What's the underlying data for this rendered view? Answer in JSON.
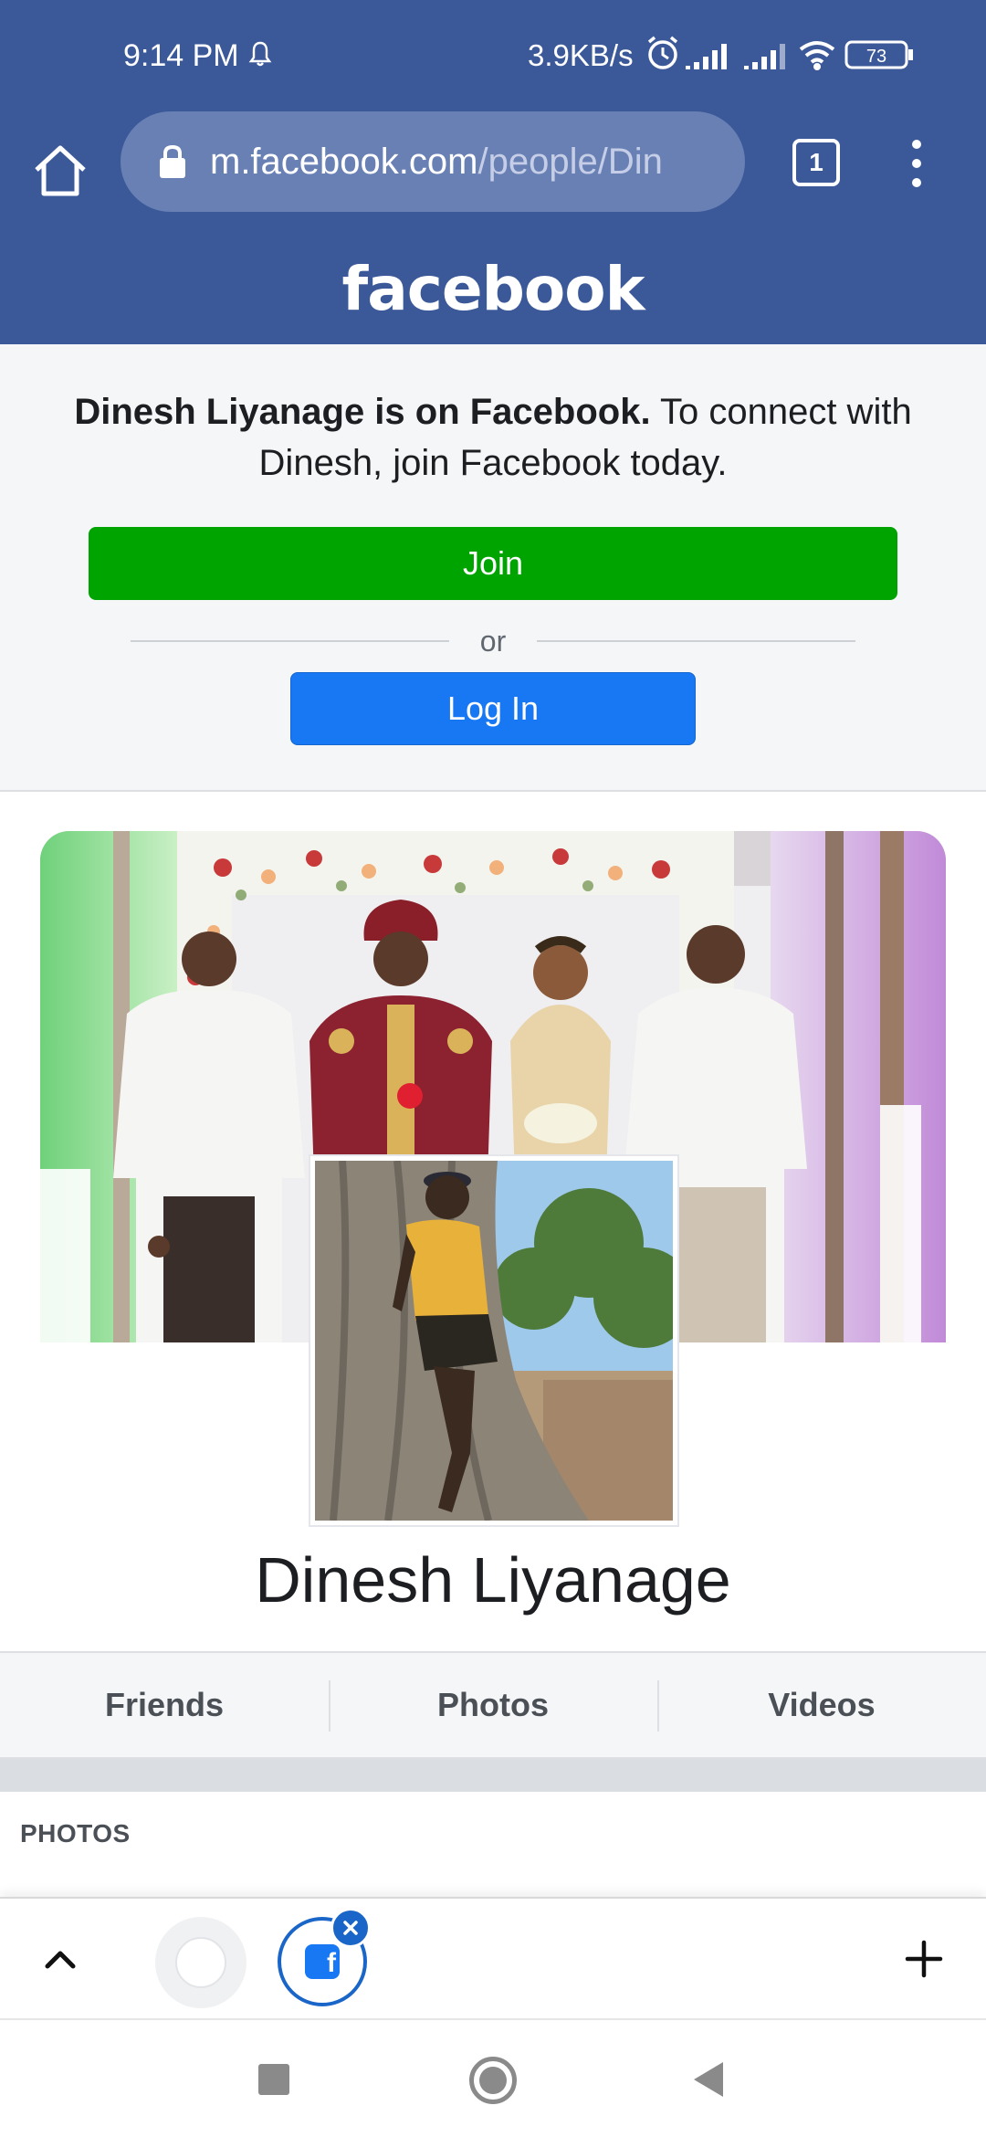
{
  "status_bar": {
    "time": "9:14 PM",
    "network_speed": "3.9KB/s",
    "battery": "73",
    "icons": [
      "bell-icon",
      "alarm-icon",
      "signal-icon",
      "signal-icon",
      "wifi-icon",
      "battery-icon"
    ]
  },
  "browser": {
    "url_host": "m.facebook.com",
    "url_path": "/people/Din",
    "tab_count": "1"
  },
  "header": {
    "logo": "facebook"
  },
  "promo": {
    "bold_text": "Dinesh Liyanage is on Facebook.",
    "rest_text": " To connect with Dinesh, join Facebook today.",
    "join_label": "Join",
    "or_label": "or",
    "login_label": "Log In"
  },
  "profile": {
    "name": "Dinesh Liyanage"
  },
  "profile_nav": [
    {
      "label": "Friends"
    },
    {
      "label": "Photos"
    },
    {
      "label": "Videos"
    }
  ],
  "photos_section": {
    "title": "PHOTOS"
  },
  "colors": {
    "brand": "#3b5998",
    "join": "#00a400",
    "login": "#1877f2"
  }
}
